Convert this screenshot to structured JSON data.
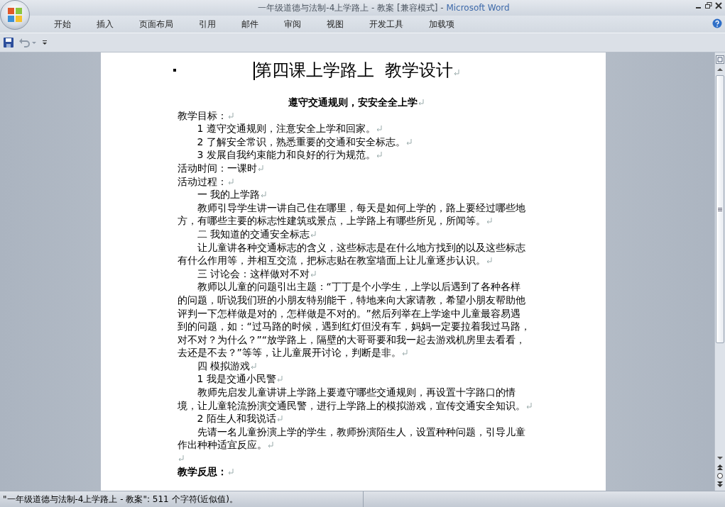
{
  "window": {
    "title": "一年级道德与法制-4上学路上 - 教案 [兼容模式] -",
    "app": "Microsoft Word"
  },
  "ribbon_tabs": [
    {
      "label": "开始"
    },
    {
      "label": "插入"
    },
    {
      "label": "页面布局"
    },
    {
      "label": "引用"
    },
    {
      "label": "邮件"
    },
    {
      "label": "审阅"
    },
    {
      "label": "视图"
    },
    {
      "label": "开发工具"
    },
    {
      "label": "加载项"
    }
  ],
  "document": {
    "title": "第四课上学路上  教学设计",
    "paragraphs": [
      {
        "kind": "subtitle",
        "text": "遵守交通规则，安安全全上学"
      },
      {
        "kind": "label",
        "text": "教学目标："
      },
      {
        "kind": "indent",
        "text": "1 遵守交通规则，注意安全上学和回家。"
      },
      {
        "kind": "indent",
        "text": "2 了解安全常识，熟悉重要的交通和安全标志。"
      },
      {
        "kind": "indent",
        "text": "3 发展自我约束能力和良好的行为规范。"
      },
      {
        "kind": "label",
        "text": "活动时间：一课时"
      },
      {
        "kind": "label",
        "text": "活动过程："
      },
      {
        "kind": "indent",
        "text": "一 我的上学路"
      },
      {
        "kind": "indent",
        "lines": [
          "教师引导学生讲一讲自己住在哪里，每天是如何上学的，路上要经过哪些地",
          "方，有哪些主要的标志性建筑或景点，上学路上有哪些所见，所闻等。"
        ]
      },
      {
        "kind": "indent",
        "text": "二 我知道的交通安全标志"
      },
      {
        "kind": "indent",
        "lines": [
          "让儿童讲各种交通标志的含义，这些标志是在什么地方找到的以及这些标志",
          "有什么作用等，并相互交流，把标志贴在教室墙面上让儿童逐步认识。"
        ]
      },
      {
        "kind": "indent",
        "text": "三 讨论会：这样做对不对"
      },
      {
        "kind": "indent",
        "lines": [
          "教师以儿童的问题引出主题：“丁丁是个小学生，上学以后遇到了各种各样",
          "的问题，听说我们班的小朋友特别能干，特地来向大家请教，希望小朋友帮助他",
          "评判一下怎样做是对的，怎样做是不对的。”然后列举在上学途中儿童最容易遇",
          "到的问题，如：“过马路的时候，遇到红灯但没有车，妈妈一定要拉着我过马路，",
          "对不对？为什么？”“放学路上，隔壁的大哥哥要和我一起去游戏机房里去看看，",
          "去还是不去？”等等，让儿童展开讨论，判断是非。"
        ]
      },
      {
        "kind": "indent",
        "text": "四 模拟游戏"
      },
      {
        "kind": "indent",
        "text": "1 我是交通小民警"
      },
      {
        "kind": "indent",
        "lines": [
          "教师先启发儿童讲讲上学路上要遵守哪些交通规则，再设置十字路口的情",
          "境，让儿童轮流扮演交通民警，进行上学路上的模拟游戏，宣传交通安全知识。"
        ]
      },
      {
        "kind": "indent",
        "text": "2 陌生人和我说话"
      },
      {
        "kind": "indent",
        "lines": [
          "先请一名儿童扮演上学的学生，教师扮演陌生人，设置种种问题，引导儿童",
          "作出种种适宜反应。"
        ]
      },
      {
        "kind": "empty"
      },
      {
        "kind": "bold",
        "text": "教学反思："
      }
    ]
  },
  "status_bar": {
    "text": "\"一年级道德与法制-4上学路上 - 教案\": 511 个字符(近似值)。"
  }
}
